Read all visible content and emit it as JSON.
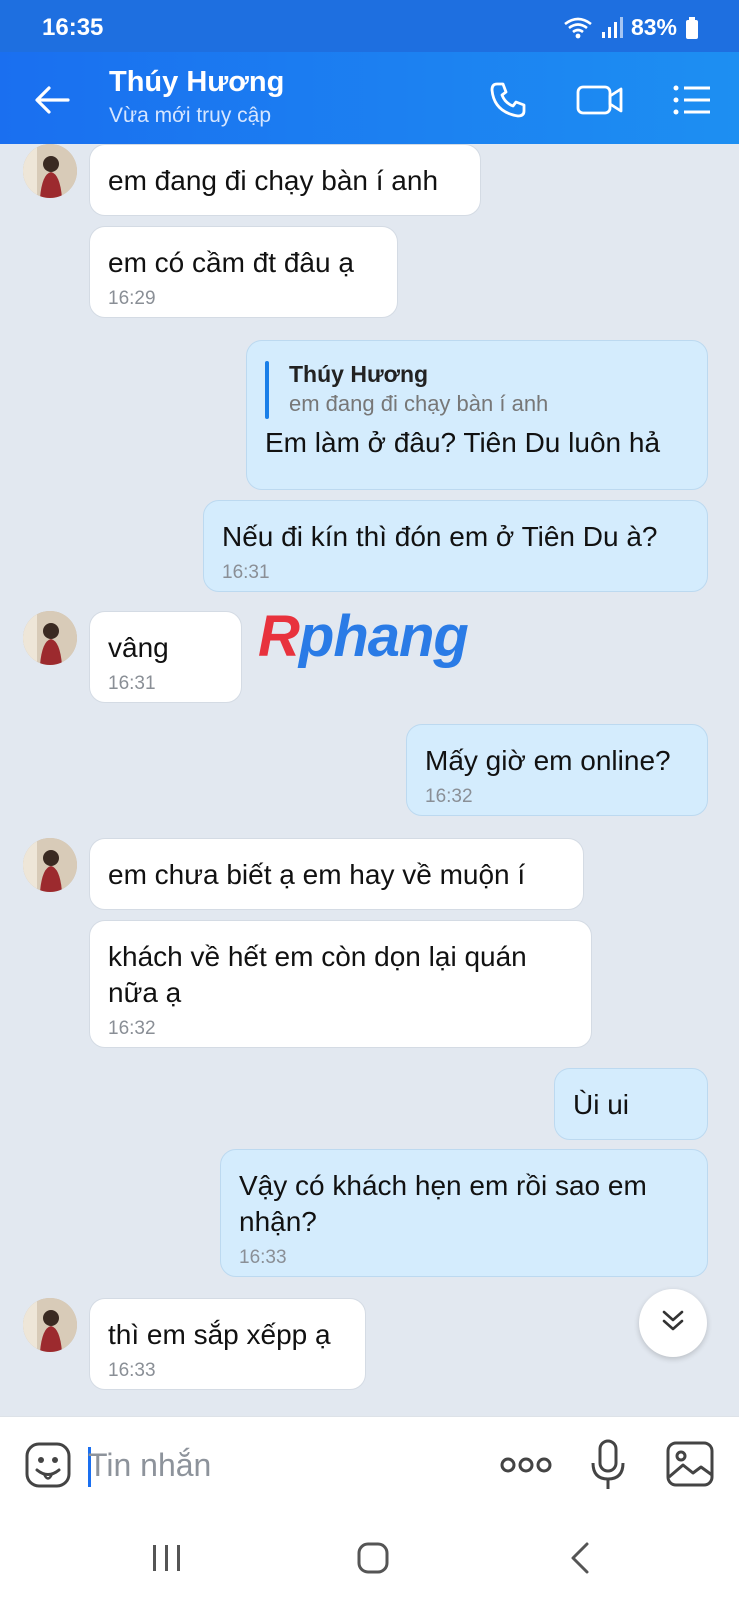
{
  "status_bar": {
    "time": "16:35",
    "battery": "83%"
  },
  "header": {
    "contact_name": "Thúy Hương",
    "contact_status": "Vừa mới truy cập",
    "accent": "#1a6ff0"
  },
  "messages": [
    {
      "dir": "in",
      "text": "em đang đi chạy bàn í anh",
      "time": ""
    },
    {
      "dir": "in",
      "text": "em có cầm đt đâu ạ",
      "time": "16:29"
    },
    {
      "dir": "out",
      "quote_name": "Thúy Hương",
      "quote_text": "em đang đi chạy bàn í anh",
      "text": "Em làm ở đâu? Tiên Du luôn hả",
      "time": ""
    },
    {
      "dir": "out",
      "text": "Nếu đi kín thì đón em ở Tiên Du à?",
      "time": "16:31"
    },
    {
      "dir": "in",
      "text": "vâng",
      "time": "16:31"
    },
    {
      "dir": "out",
      "text": "Mấy giờ em online?",
      "time": "16:32"
    },
    {
      "dir": "in",
      "text": "em chưa biết ạ em hay về muộn í",
      "time": ""
    },
    {
      "dir": "in",
      "text": "khách về hết em còn dọn lại quán nữa ạ",
      "time": "16:32"
    },
    {
      "dir": "out",
      "text": "Ùi ui",
      "time": ""
    },
    {
      "dir": "out",
      "text": "Vậy có khách hẹn em rồi sao em nhận?",
      "time": "16:33"
    },
    {
      "dir": "in",
      "text": "thì em sắp xếpp ạ",
      "time": "16:33"
    }
  ],
  "watermark": {
    "first": "R",
    "rest": "phang"
  },
  "composer": {
    "placeholder": "Tin nhắn"
  }
}
